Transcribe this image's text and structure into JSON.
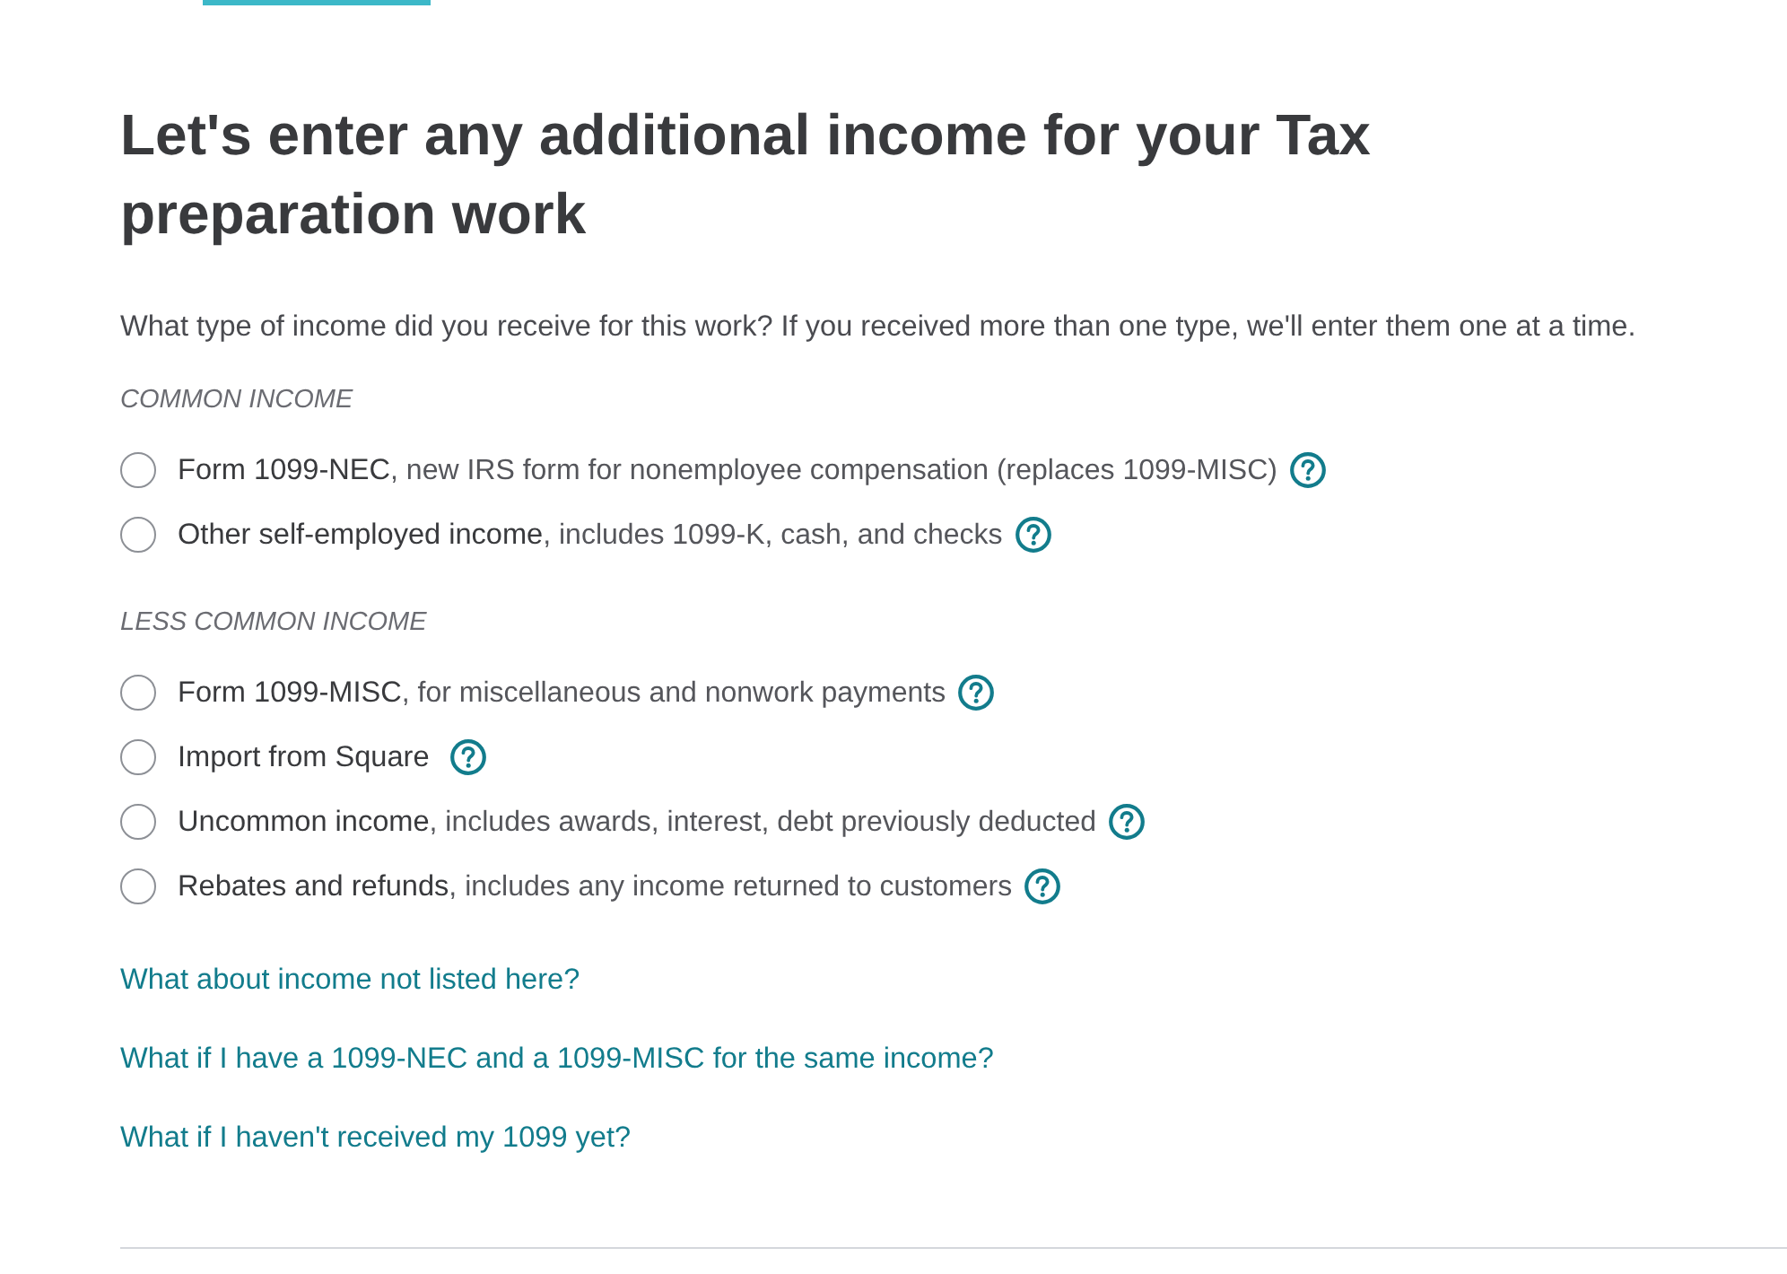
{
  "heading": "Let's enter any additional income for your Tax preparation work",
  "intro": "What type of income did you receive for this work? If you received more than one type, we'll enter them one at a time.",
  "sections": [
    {
      "label": "COMMON INCOME",
      "options": [
        {
          "name": "Form 1099-NEC",
          "description": ", new IRS form for nonemployee compensation (replaces 1099-MISC)",
          "selected": false
        },
        {
          "name": "Other self-employed income",
          "description": ", includes 1099-K, cash, and checks",
          "selected": false
        }
      ]
    },
    {
      "label": "LESS COMMON INCOME",
      "options": [
        {
          "name": "Form 1099-MISC",
          "description": ", for miscellaneous and nonwork payments",
          "selected": false
        },
        {
          "name": "Import from Square",
          "selected": false
        },
        {
          "name": "Uncommon income",
          "description": ", includes awards, interest, debt previously deducted",
          "selected": false
        },
        {
          "name": "Rebates and refunds",
          "description": ", includes any income returned to customers",
          "selected": false
        }
      ]
    }
  ],
  "links": [
    "What about income not listed here?",
    "What if I have a 1099-NEC and a 1099-MISC for the same income?",
    "What if I haven't received my 1099 yet?"
  ]
}
